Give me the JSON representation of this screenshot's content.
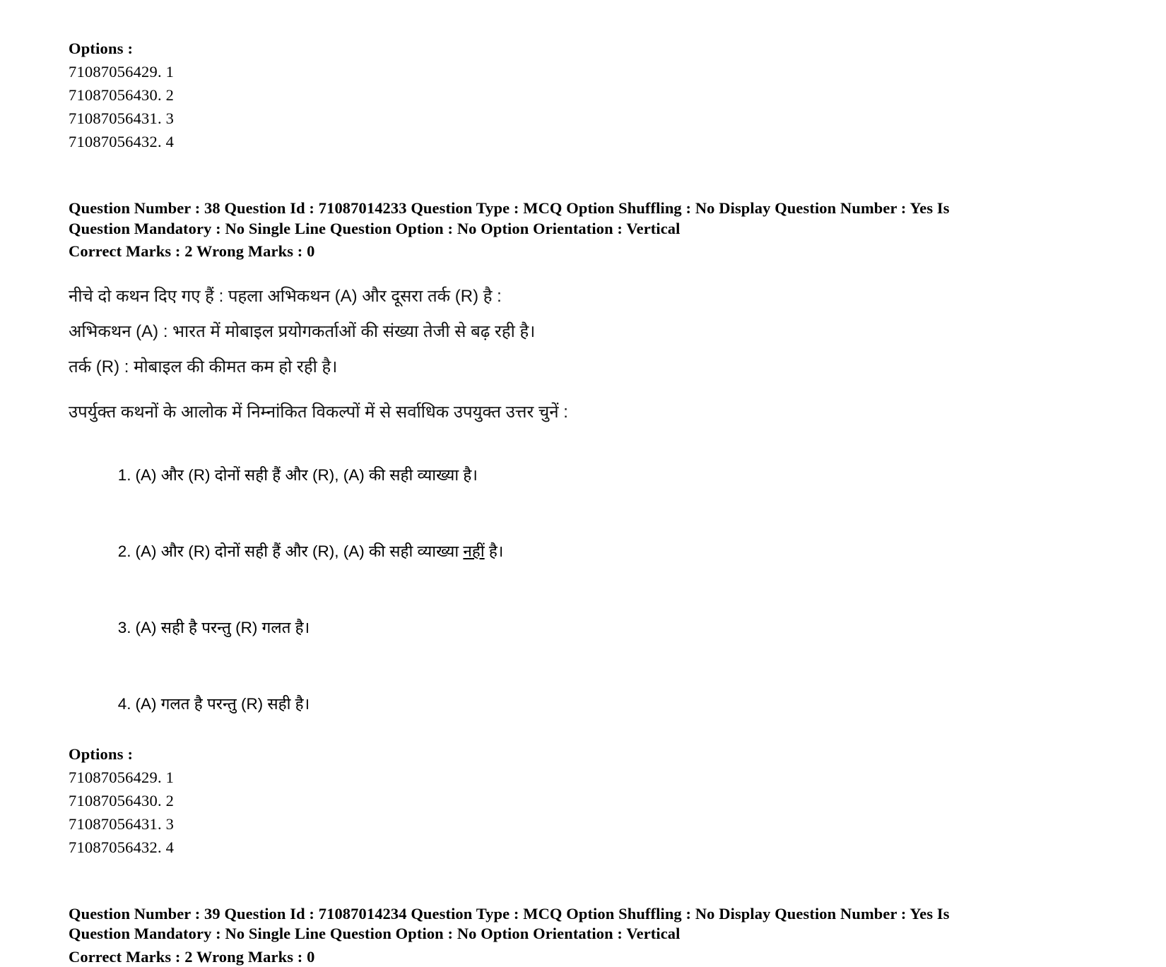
{
  "document": {
    "page_background": "#ffffff",
    "text_color": "#000000"
  },
  "top_options": {
    "heading": "Options :",
    "items": [
      "71087056429. 1",
      "71087056430. 2",
      "71087056431. 3",
      "71087056432. 4"
    ]
  },
  "question_38": {
    "meta_line_1": "Question Number : 38 Question Id : 71087014233 Question Type : MCQ Option Shuffling : No Display Question Number : Yes Is Question Mandatory : No Single Line Question Option : No Option Orientation : Vertical",
    "meta_marks": "Correct Marks : 2 Wrong Marks : 0",
    "stem": "नीचे दो कथन दिए गए हैं : पहला अभिकथन (A) और दूसरा तर्क (R) है :",
    "assertion": "अभिकथन (A) : भारत में मोबाइल प्रयोगकर्ताओं की संख्या तेजी से बढ़ रही है।",
    "reason": "तर्क (R) : मोबाइल की कीमत कम हो रही है।",
    "instruction": "उपर्युक्त कथनों के आलोक में निम्नांकित विकल्पों में से सर्वाधिक उपयुक्त उत्तर चुनें :",
    "choices": [
      {
        "number": "1.",
        "text_before": "(A) और (R) दोनों सही हैं और (R), (A) की सही व्याख्या है।",
        "underlined": "",
        "text_after": ""
      },
      {
        "number": "2.",
        "text_before": "(A) और (R) दोनों सही हैं और (R), (A) की सही व्याख्या ",
        "underlined": "नहीं",
        "text_after": " है।"
      },
      {
        "number": "3.",
        "text_before": "(A) सही है परन्तु (R) गलत है।",
        "underlined": "",
        "text_after": ""
      },
      {
        "number": "4.",
        "text_before": "(A) गलत है परन्तु (R) सही है।",
        "underlined": "",
        "text_after": ""
      }
    ],
    "options_heading": "Options :",
    "option_items": [
      "71087056429. 1",
      "71087056430. 2",
      "71087056431. 3",
      "71087056432. 4"
    ]
  },
  "question_39": {
    "meta_line_1": "Question Number : 39 Question Id : 71087014234 Question Type : MCQ Option Shuffling : No Display Question Number : Yes Is Question Mandatory : No Single Line Question Option : No Option Orientation : Vertical",
    "meta_marks": "Correct Marks : 2 Wrong Marks : 0"
  }
}
